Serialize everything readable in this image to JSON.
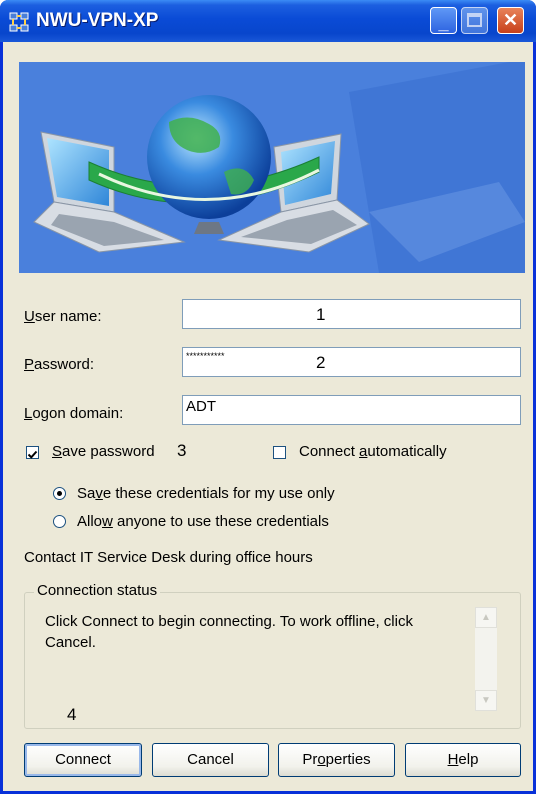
{
  "window": {
    "title": "NWU-VPN-XP",
    "controls": {
      "minimize_icon": "minimize-icon",
      "maximize_icon": "maximize-icon",
      "close_icon": "close-icon"
    }
  },
  "banner": {
    "image": "network-globe-laptops-icon"
  },
  "form": {
    "username_label_u": "U",
    "username_label_rest": "ser name:",
    "username_value": "",
    "password_label_p": "P",
    "password_label_rest": "assword:",
    "password_value": "***********",
    "domain_label_l": "L",
    "domain_label_mid": "ogon domain:",
    "domain_value": "ADT"
  },
  "annotations": {
    "one": "1",
    "two": "2",
    "three": "3",
    "four": "4"
  },
  "options": {
    "save_password_s": "S",
    "save_password_rest": "ave password",
    "save_password_checked": true,
    "connect_auto_pre": "Connect ",
    "connect_auto_a": "a",
    "connect_auto_rest": "utomatically",
    "connect_auto_checked": false,
    "cred_me_pre": "Sa",
    "cred_me_v": "v",
    "cred_me_rest": "e these credentials for my use only",
    "cred_any_pre": "Allo",
    "cred_any_w": "w",
    "cred_any_rest": " anyone to use these credentials",
    "selected_credential": "me"
  },
  "contact_text": "Contact IT Service Desk during office hours",
  "status": {
    "title": "Connection status",
    "line1": "Click Connect to begin connecting.  To work offline, click",
    "line2": "Cancel."
  },
  "buttons": {
    "connect": "Connect",
    "cancel": "Cancel",
    "properties_pre": "Pr",
    "properties_o": "o",
    "properties_rest": "perties",
    "help_h": "H",
    "help_rest": "elp"
  },
  "colors": {
    "title_bar": "#0a4bd6",
    "dialog_bg": "#ece9d8",
    "banner_bg": "#3f74d7"
  }
}
